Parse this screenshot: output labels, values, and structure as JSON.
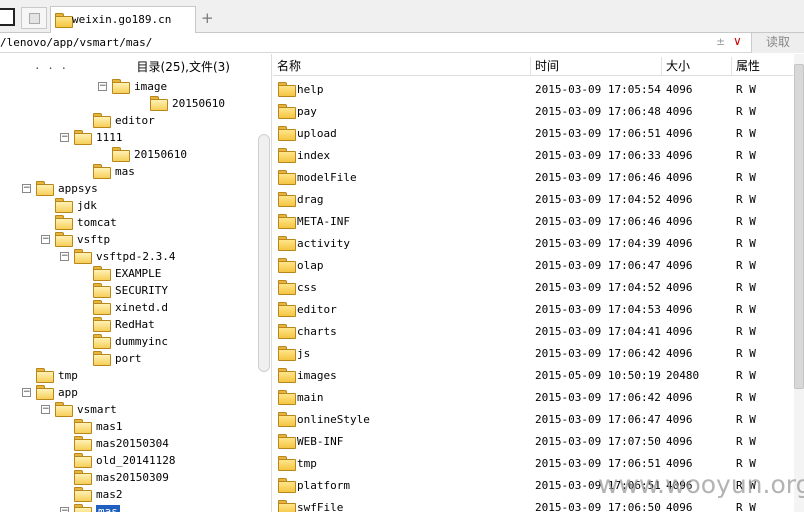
{
  "tabs": {
    "active_label": "weixin.go189.cn",
    "new_tab": "+"
  },
  "address": {
    "path": "/lenovo/app/vsmart/mas/",
    "dropdown_glyph": "±",
    "chevron": "∨",
    "read_label": "读取"
  },
  "tree": {
    "parent_dots": ". . .",
    "stats": "目录(25),文件(3)",
    "nodes": [
      {
        "label": "image",
        "toggle": "−"
      },
      {
        "label": "20150610",
        "toggle": ""
      },
      {
        "label": "editor",
        "toggle": ""
      },
      {
        "label": "1111",
        "toggle": "−"
      },
      {
        "label": "20150610",
        "toggle": ""
      },
      {
        "label": "mas",
        "toggle": ""
      },
      {
        "label": "appsys",
        "toggle": "−"
      },
      {
        "label": "jdk",
        "toggle": ""
      },
      {
        "label": "tomcat",
        "toggle": ""
      },
      {
        "label": "vsftp",
        "toggle": "−"
      },
      {
        "label": "vsftpd-2.3.4",
        "toggle": "−"
      },
      {
        "label": "EXAMPLE",
        "toggle": ""
      },
      {
        "label": "SECURITY",
        "toggle": ""
      },
      {
        "label": "xinetd.d",
        "toggle": ""
      },
      {
        "label": "RedHat",
        "toggle": ""
      },
      {
        "label": "dummyinc",
        "toggle": ""
      },
      {
        "label": "port",
        "toggle": ""
      },
      {
        "label": "tmp",
        "toggle": ""
      },
      {
        "label": "app",
        "toggle": "−"
      },
      {
        "label": "vsmart",
        "toggle": "−"
      },
      {
        "label": "mas1",
        "toggle": ""
      },
      {
        "label": "mas20150304",
        "toggle": ""
      },
      {
        "label": "old_20141128",
        "toggle": ""
      },
      {
        "label": "mas20150309",
        "toggle": ""
      },
      {
        "label": "mas2",
        "toggle": ""
      },
      {
        "label": "mas",
        "toggle": "−",
        "selected": true
      }
    ]
  },
  "list": {
    "headers": {
      "name": "名称",
      "time": "时间",
      "size": "大小",
      "attr": "属性"
    },
    "rows": [
      {
        "name": "help",
        "time": "2015-03-09 17:05:54",
        "size": "4096",
        "attr": "R W"
      },
      {
        "name": "pay",
        "time": "2015-03-09 17:06:48",
        "size": "4096",
        "attr": "R W"
      },
      {
        "name": "upload",
        "time": "2015-03-09 17:06:51",
        "size": "4096",
        "attr": "R W"
      },
      {
        "name": "index",
        "time": "2015-03-09 17:06:33",
        "size": "4096",
        "attr": "R W"
      },
      {
        "name": "modelFile",
        "time": "2015-03-09 17:06:46",
        "size": "4096",
        "attr": "R W"
      },
      {
        "name": "drag",
        "time": "2015-03-09 17:04:52",
        "size": "4096",
        "attr": "R W"
      },
      {
        "name": "META-INF",
        "time": "2015-03-09 17:06:46",
        "size": "4096",
        "attr": "R W"
      },
      {
        "name": "activity",
        "time": "2015-03-09 17:04:39",
        "size": "4096",
        "attr": "R W"
      },
      {
        "name": "olap",
        "time": "2015-03-09 17:06:47",
        "size": "4096",
        "attr": "R W"
      },
      {
        "name": "css",
        "time": "2015-03-09 17:04:52",
        "size": "4096",
        "attr": "R W"
      },
      {
        "name": "editor",
        "time": "2015-03-09 17:04:53",
        "size": "4096",
        "attr": "R W"
      },
      {
        "name": "charts",
        "time": "2015-03-09 17:04:41",
        "size": "4096",
        "attr": "R W"
      },
      {
        "name": "js",
        "time": "2015-03-09 17:06:42",
        "size": "4096",
        "attr": "R W"
      },
      {
        "name": "images",
        "time": "2015-05-09 10:50:19",
        "size": "20480",
        "attr": "R W"
      },
      {
        "name": "main",
        "time": "2015-03-09 17:06:42",
        "size": "4096",
        "attr": "R W"
      },
      {
        "name": "onlineStyle",
        "time": "2015-03-09 17:06:47",
        "size": "4096",
        "attr": "R W"
      },
      {
        "name": "WEB-INF",
        "time": "2015-03-09 17:07:50",
        "size": "4096",
        "attr": "R W"
      },
      {
        "name": "tmp",
        "time": "2015-03-09 17:06:51",
        "size": "4096",
        "attr": "R W"
      },
      {
        "name": "platform",
        "time": "2015-03-09 17:06:51",
        "size": "4096",
        "attr": "R W"
      },
      {
        "name": "swfFile",
        "time": "2015-03-09 17:06:50",
        "size": "4096",
        "attr": "R W"
      }
    ]
  },
  "watermark": "www.wooyun.org",
  "colors": {
    "folder": "#f5c542",
    "selection": "#1f5fbf",
    "chevron": "#cc0000"
  }
}
